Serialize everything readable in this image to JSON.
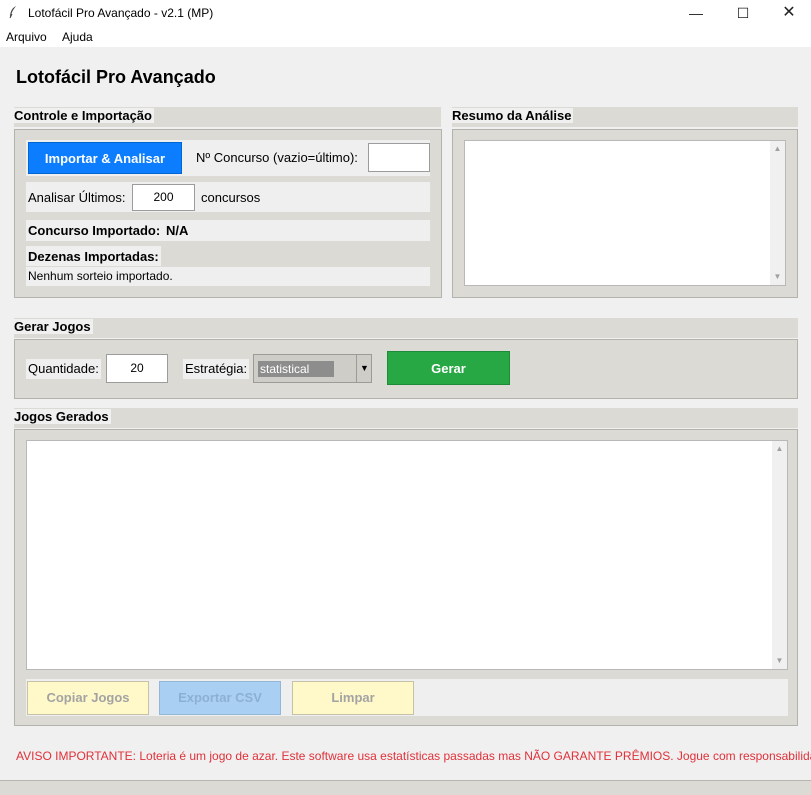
{
  "window": {
    "title": "Lotofácil Pro Avançado - v2.1 (MP)",
    "app_icon": "feather-icon",
    "minimize": "—",
    "maximize": "☐",
    "close": "✕"
  },
  "menu": {
    "items": [
      {
        "label": "Arquivo"
      },
      {
        "label": "Ajuda"
      }
    ]
  },
  "app_title": "Lotofácil Pro Avançado",
  "controle": {
    "section_label": "Controle e Importação",
    "import_button": "Importar & Analisar",
    "concurso_label": "Nº Concurso (vazio=último):",
    "concurso_value": "",
    "analisar_label": "Analisar Últimos:",
    "analisar_value": "200",
    "analisar_suffix": "concursos",
    "concurso_importado_label": "Concurso Importado:",
    "concurso_importado_value": "N/A",
    "dezenas_label": "Dezenas Importadas:",
    "dezenas_value": "Nenhum sorteio importado."
  },
  "resumo": {
    "section_label": "Resumo da Análise",
    "text": ""
  },
  "gerar": {
    "section_label": "Gerar Jogos",
    "quantidade_label": "Quantidade:",
    "quantidade_value": "20",
    "estrategia_label": "Estratégia:",
    "estrategia_value": "statistical",
    "gerar_button": "Gerar"
  },
  "jogos": {
    "section_label": "Jogos Gerados",
    "text": "",
    "copiar_button": "Copiar Jogos",
    "exportar_button": "Exportar CSV",
    "limpar_button": "Limpar"
  },
  "warning": "AVISO IMPORTANTE: Loteria é um jogo de azar. Este software usa estatísticas passadas mas NÃO GARANTE PRÊMIOS. Jogue com responsabilidade.",
  "colors": {
    "import_button": "#0d7dff",
    "gerar_button": "#28a745",
    "warning_text": "#e0313a",
    "copy_limpar_button": "#fff8c9",
    "export_button": "#a9d0f3"
  }
}
